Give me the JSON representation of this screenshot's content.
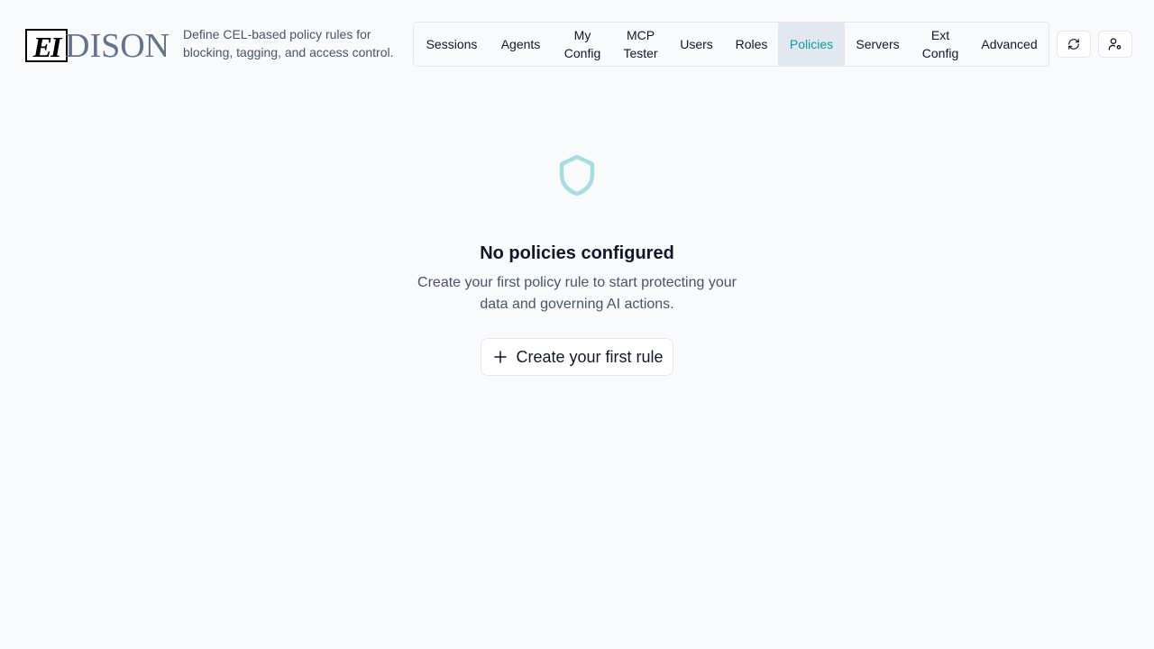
{
  "app": {
    "logo_mark": "EI",
    "logo_text": "DISON",
    "subtitle": "Define CEL-based policy rules for blocking, tagging, and access control."
  },
  "nav": {
    "items": [
      {
        "label": "Sessions",
        "active": false
      },
      {
        "label": "Agents",
        "active": false
      },
      {
        "label": "My Config",
        "active": false
      },
      {
        "label": "MCP Tester",
        "active": false
      },
      {
        "label": "Users",
        "active": false
      },
      {
        "label": "Roles",
        "active": false
      },
      {
        "label": "Policies",
        "active": true
      },
      {
        "label": "Servers",
        "active": false
      },
      {
        "label": "Ext Config",
        "active": false
      },
      {
        "label": "Advanced",
        "active": false
      }
    ]
  },
  "actions": {
    "refresh_icon": "refresh-icon",
    "user_settings_icon": "user-settings-icon"
  },
  "empty_state": {
    "icon": "shield-icon",
    "title": "No policies configured",
    "description": "Create your first policy rule to start protecting your data and governing AI actions.",
    "button_label": "Create your first rule",
    "button_icon": "plus-icon"
  },
  "colors": {
    "accent": "#0d9aa6",
    "shield": "#a5dde3",
    "background": "#f8fafc",
    "active_tab_bg": "#e2e8f0"
  }
}
